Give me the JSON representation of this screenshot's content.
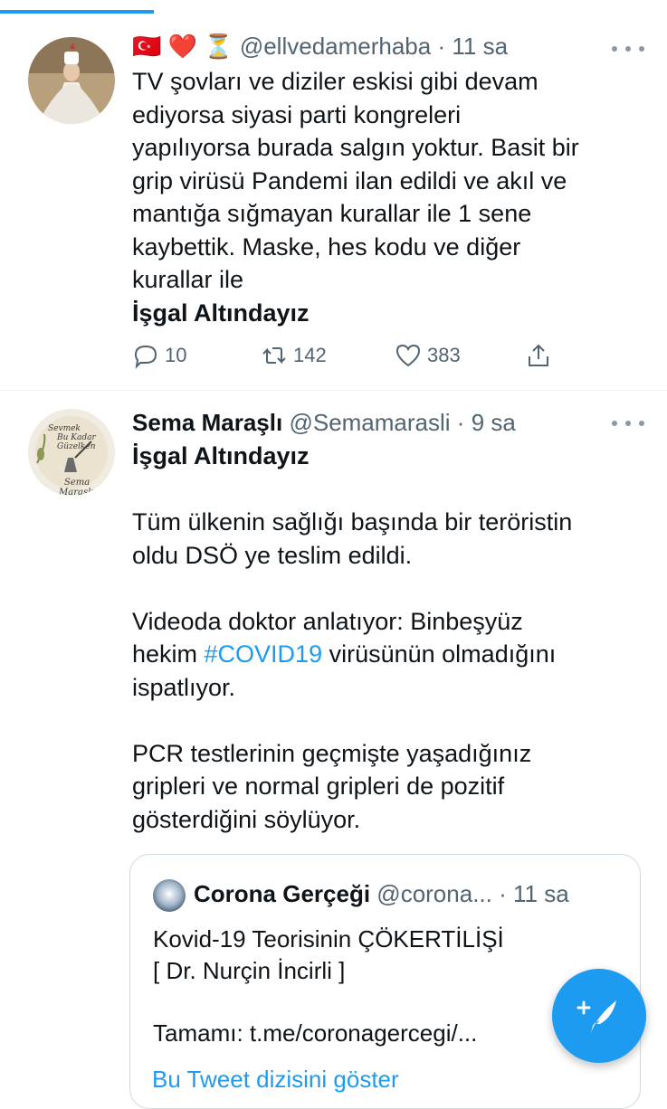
{
  "tweet1": {
    "emoji_flag": "🇹🇷",
    "emoji_heart": "❤️",
    "emoji_hourglass": "⏳",
    "handle": "@ellvedamerhaba",
    "separator": "·",
    "time": "11 sa",
    "text_lines": [
      "TV şovları ve diziler eskisi gibi devam",
      "ediyorsa siyasi parti kongreleri",
      "yapılıyorsa burada salgın yoktur. Basit bir",
      "grip virüsü Pandemi ilan edildi ve akıl ve",
      "mantığa sığmayan kurallar ile 1 sene",
      "kaybettik. Maske, hes kodu ve diğer",
      "kurallar ile"
    ],
    "bold_line": "İşgal Altındayız",
    "replies": "10",
    "retweets": "142",
    "likes": "383"
  },
  "tweet2": {
    "name": "Sema Maraşlı",
    "handle": "@Semamarasli",
    "separator": "·",
    "time": "9 sa",
    "avatar_text": [
      "Sevmek",
      "Bu Kadar",
      "Güzelken",
      "Sema",
      "Maraslı"
    ],
    "bold_line": "İşgal Altındayız",
    "para1": [
      "Tüm ülkenin sağlığı başında bir teröristin",
      "oldu DSÖ ye teslim edildi."
    ],
    "para2_line1": "Videoda doktor anlatıyor: Binbeşyüz",
    "para2_prefix": "hekim ",
    "hashtag": "#COVID19",
    "para2_suffix": " virüsünün olmadığını",
    "para2_line3": "ispatlıyor.",
    "para3": [
      "PCR testlerinin geçmişte yaşadığınız",
      "gripleri ve normal gripleri de pozitif",
      "gösterdiğini söylüyor."
    ]
  },
  "quote": {
    "name": "Corona Gerçeği",
    "handle": "@corona...",
    "separator": "·",
    "time": "11 sa",
    "lines": [
      "Kovid-19 Teorisinin ÇÖKERTİLİŞİ",
      "[ Dr. Nurçin İncirli ]",
      "",
      "Tamamı: t.me/coronagercegi/..."
    ]
  },
  "show_thread": "Bu Tweet dizisini göster",
  "colors": {
    "accent": "#1d9bf0",
    "muted": "#536471",
    "border": "#cfd9de"
  },
  "progress": 0.23
}
